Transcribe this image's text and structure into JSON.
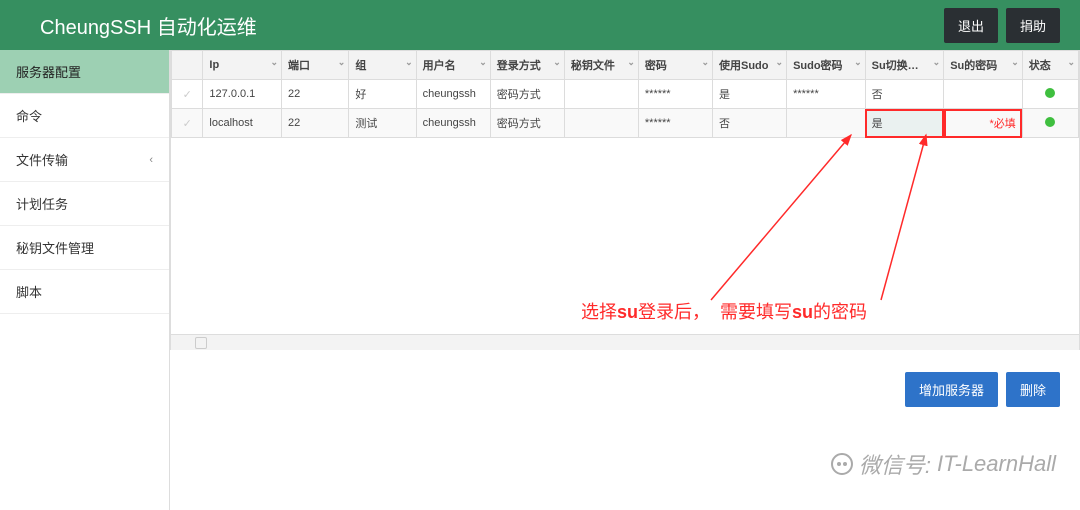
{
  "topbar": {
    "title": "CheungSSH 自动化运维",
    "logout": "退出",
    "donate": "捐助"
  },
  "sidebar": {
    "items": [
      {
        "label": "服务器配置",
        "active": true
      },
      {
        "label": "命令"
      },
      {
        "label": "文件传输",
        "chev": "‹"
      },
      {
        "label": "计划任务"
      },
      {
        "label": "秘钥文件管理"
      },
      {
        "label": "脚本"
      }
    ]
  },
  "table": {
    "columns": [
      "Ip",
      "端口",
      "组",
      "用户名",
      "登录方式",
      "秘钥文件",
      "密码",
      "使用Sudo",
      "Sudo密码",
      "Su切换…",
      "Su的密码",
      "状态"
    ],
    "rows": [
      {
        "ip": "127.0.0.1",
        "port": "22",
        "group": "好",
        "user": "cheungssh",
        "login": "密码方式",
        "keyfile": "",
        "pwd": "******",
        "use_sudo": "是",
        "sudo_pwd": "******",
        "su_switch": "否",
        "su_pwd": "",
        "status": "ok"
      },
      {
        "ip": "localhost",
        "port": "22",
        "group": "测试",
        "user": "cheungssh",
        "login": "密码方式",
        "keyfile": "",
        "pwd": "******",
        "use_sudo": "否",
        "sudo_pwd": "",
        "su_switch": "是",
        "su_pwd": "*必填",
        "status": "ok",
        "hl_su": true,
        "hl_pw": true
      }
    ]
  },
  "footer": {
    "add": "增加服务器",
    "del": "删除"
  },
  "annotation": {
    "part1": "选择",
    "su1": "su",
    "part2": "登录后，",
    "part3": "需要填写",
    "su2": "su",
    "part4": "的密码"
  },
  "watermark": {
    "label": "微信号:",
    "value": "IT-LearnHall"
  }
}
